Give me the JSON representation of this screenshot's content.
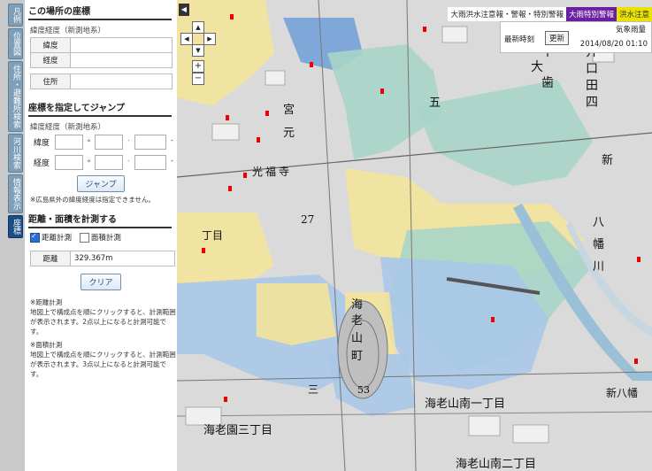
{
  "tabs": [
    "凡例",
    "位置図",
    "住所・避難所検索",
    "河川検索",
    "情報表示",
    "座標"
  ],
  "active_tab": 5,
  "coords_section": {
    "title": "この場所の座標",
    "subtitle": "緯度経度（新測地系）",
    "lat_label": "緯度",
    "lng_label": "経度",
    "lat_value": "",
    "lng_value": "",
    "address_label": "住所",
    "address_value": ""
  },
  "jump_section": {
    "title": "座標を指定してジャンプ",
    "subtitle": "緯度経度（新測地系）",
    "lat_label": "緯度",
    "lng_label": "経度",
    "deg": "°",
    "min": "′",
    "sec": "″",
    "button": "ジャンプ",
    "note": "※広島県外の緯度経度は指定できません。"
  },
  "measure_section": {
    "title": "距離・面積を計測する",
    "distance_check": "距離計測",
    "area_check": "面積計測",
    "distance_checked": true,
    "area_checked": false,
    "result_label": "距離",
    "result_value": "329.367m",
    "clear_button": "クリア",
    "note1_title": "※距離計測",
    "note1_body": "地図上で構成点を順にクリックすると、計測範囲が表示されます。2点以上になると計測可能です。",
    "note2_title": "※面積計測",
    "note2_body": "地図上で構成点を順にクリックすると、計測範囲が表示されます。3点以上になると計測可能です。"
  },
  "legend": {
    "text": "大雨洪水注意報・警報・特別警報",
    "tag1": "大雨特別警報",
    "tag2": "洪水注意",
    "tag1_color": "#6a1ea0",
    "tag2_color": "#e8e400"
  },
  "info_box": {
    "label_top": "気象雨量",
    "latest_label": "最新時刻",
    "refresh_button": "更新",
    "timestamp": "2014/08/20 01:10"
  },
  "map_controls": {
    "up": "▲",
    "down": "▼",
    "left": "◀",
    "right": "▶",
    "zoom_in": "+",
    "zoom_out": "−",
    "collapse": "◀"
  },
  "map_labels": [
    "大",
    "千",
    "歯",
    "井",
    "口",
    "田",
    "四",
    "丁",
    "目",
    "五",
    "宮",
    "元",
    "光",
    "福",
    "寺",
    "27",
    "丁目",
    "海",
    "老",
    "山",
    "町",
    "53",
    "三",
    "海老山南一丁目",
    "海老園三丁目",
    "海老山南二丁目",
    "新",
    "八",
    "幡",
    "川",
    "新八幡"
  ],
  "colors": {
    "blue": "#a9c8e8",
    "teal": "#a9d4c8",
    "yellow": "#f3e39a",
    "dark_blue": "#6f9fd8",
    "panel_accent": "#1a4e86"
  }
}
